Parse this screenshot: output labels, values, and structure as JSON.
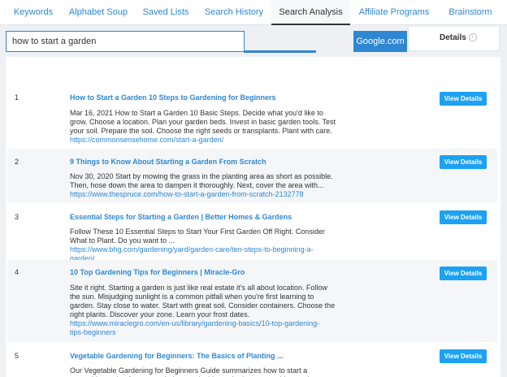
{
  "tabs": [
    {
      "label": "Keywords"
    },
    {
      "label": "Alphabet Soup"
    },
    {
      "label": "Saved Lists"
    },
    {
      "label": "Search History"
    },
    {
      "label": "Search Analysis"
    },
    {
      "label": "Affiliate Programs"
    },
    {
      "label": "Brainstorm"
    }
  ],
  "active_tab": "Search Analysis",
  "search": {
    "value": "how to start a garden",
    "placeholder": ""
  },
  "engine": {
    "label": "Google.com"
  },
  "details": {
    "label": "Details",
    "icon": "info-icon"
  },
  "results": [
    {
      "rank": "1",
      "title": "How to Start a Garden 10 Steps to Gardening for Beginners",
      "snippet": "Mar 16, 2021 How to Start a Garden 10 Basic Steps. Decide what you'd like to grow. Choose a location. Plan your garden beds. Invest in basic garden tools. Test your soil. Prepare the soil. Choose the right seeds or transplants. Plant with care.",
      "url": "https://commonsensehome.com/start-a-garden/",
      "button": "View Details"
    },
    {
      "rank": "2",
      "title": "9 Things to Know About Starting a Garden From Scratch",
      "snippet": "Nov 30, 2020 Start by mowing the grass in the planting area as short as possible. Then, hose down the area to dampen it thoroughly. Next, cover the area with...",
      "url": "https://www.thespruce.com/how-to-start-a-garden-from-scratch-2132778",
      "button": "View Details"
    },
    {
      "rank": "3",
      "title": "Essential Steps for Starting a Garden | Better Homes & Gardens",
      "snippet": "Follow These 10 Essential Steps to Start Your First Garden Off Right. Consider What to Plant. Do you want to ...",
      "url": "https://www.bhg.com/gardening/yard/garden-care/ten-steps-to-beginning-a-garden/",
      "button": "View Details"
    },
    {
      "rank": "4",
      "title": "10 Top Gardening Tips for Beginners | Miracle-Gro",
      "snippet": "Site it right. Starting a garden is just like real estate it's all about location. Follow the sun. Misjudging sunlight is a common pitfall when you're first learning to garden. Stay close to water. Start with great soil. Consider containers. Choose the right plants. Discover your zone. Learn your frost dates.",
      "url": "https://www.miraclegro.com/en-us/library/gardening-basics/10-top-gardening-tips-beginners",
      "button": "View Details"
    },
    {
      "rank": "5",
      "title": "Vegetable Gardening for Beginners: The Basics of Planting ...",
      "snippet": "Our Vegetable Gardening for Beginners Guide summarizes how to start a vegetable garden from scratch, how to decide on the best vegetables to plant.",
      "url": "",
      "button": "View Details"
    }
  ]
}
